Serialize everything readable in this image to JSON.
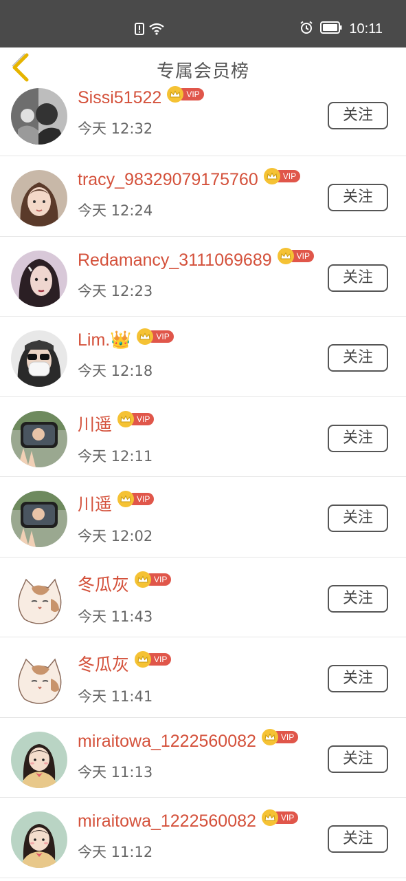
{
  "status_bar": {
    "time": "10:11",
    "icons": [
      "alert-icon",
      "wifi-icon",
      "alarm-icon",
      "battery-icon"
    ]
  },
  "header": {
    "title": "专属会员榜",
    "back_icon": "chevron-left-icon",
    "accent": "#e6b400"
  },
  "follow_label": "关注",
  "vip_label": "VIP",
  "members": [
    {
      "name": "Sissi51522",
      "time": "今天 12:32",
      "avatar": "bw-photo"
    },
    {
      "name": "tracy_98329079175760",
      "time": "今天 12:24",
      "avatar": "girl-bangs"
    },
    {
      "name": "Redamancy_3111069689",
      "time": "今天 12:23",
      "avatar": "girl-dark"
    },
    {
      "name": "Lim.👑",
      "time": "今天 12:18",
      "avatar": "mask-sunglasses"
    },
    {
      "name": "川遥",
      "time": "今天 12:11",
      "avatar": "car-mirror"
    },
    {
      "name": "川遥",
      "time": "今天 12:02",
      "avatar": "car-mirror"
    },
    {
      "name": "冬瓜灰",
      "time": "今天 11:43",
      "avatar": "cat-drawing"
    },
    {
      "name": "冬瓜灰",
      "time": "今天 11:41",
      "avatar": "cat-drawing"
    },
    {
      "name": "miraitowa_1222560082",
      "time": "今天 11:13",
      "avatar": "girl-cartoon"
    },
    {
      "name": "miraitowa_1222560082",
      "time": "今天 11:12",
      "avatar": "girl-cartoon"
    }
  ],
  "colors": {
    "name": "#d4513b",
    "vip_tag": "#e0564a",
    "crown": "#f5c234",
    "status_bar": "#4a4a4a"
  }
}
